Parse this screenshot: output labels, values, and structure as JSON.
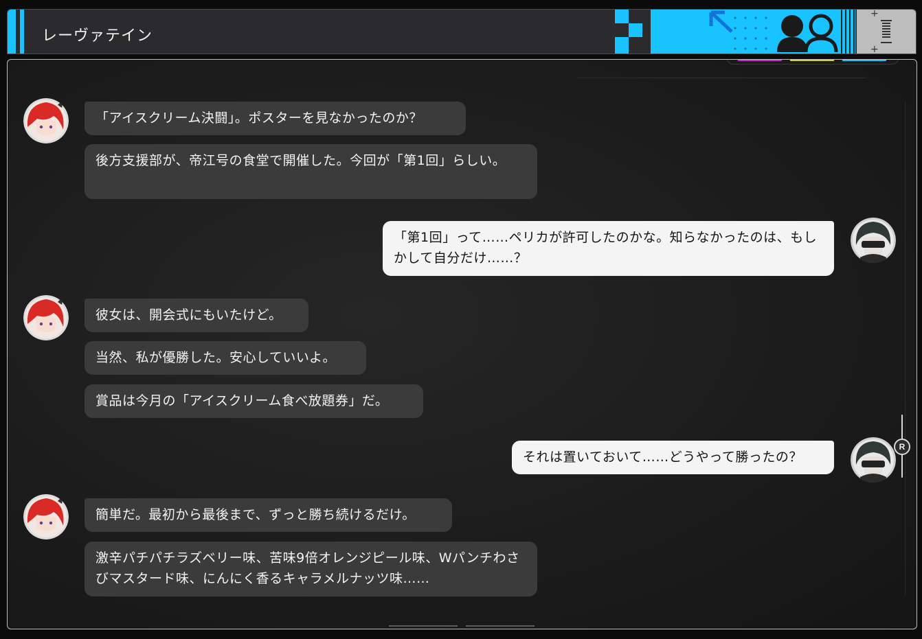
{
  "header": {
    "title": "レーヴァテイン"
  },
  "colors": {
    "accent": "#19c3ff",
    "incoming_bubble": "#3b3b3c",
    "outgoing_bubble": "#f4f4f4"
  },
  "messages": [
    {
      "sender": "contact",
      "text": "「アイスクリーム決闘」。ポスターを見なかったのか？"
    },
    {
      "sender": "contact",
      "text": "後方支援部が、帝江号の食堂で開催した。今回が「第1回」らしい。"
    },
    {
      "sender": "player",
      "text": "「第1回」って……ペリカが許可したのかな。知らなかったのは、もしかして自分だけ……？"
    },
    {
      "sender": "contact",
      "text": "彼女は、開会式にもいたけど。"
    },
    {
      "sender": "contact",
      "text": "当然、私が優勝した。安心していいよ。"
    },
    {
      "sender": "contact",
      "text": "賞品は今月の「アイスクリーム食べ放題券」だ。"
    },
    {
      "sender": "player",
      "text": "それは置いておいて……どうやって勝ったの？"
    },
    {
      "sender": "contact",
      "text": "簡単だ。最初から最後まで、ずっと勝ち続けるだけ。"
    },
    {
      "sender": "contact",
      "text": "激辛パチパチラズベリー味、苦味9倍オレンジピール味、Wパンチわさびマスタード味、にんにく香るキャラメルナッツ味……"
    }
  ],
  "scrollbar": {
    "knob_label": "R"
  },
  "icons": {
    "contact_avatar": "red-haired-girl-avatar-icon",
    "player_avatar": "masked-player-avatar-icon",
    "header_close": "close-lines-icon",
    "header_people": "contacts-icon"
  }
}
